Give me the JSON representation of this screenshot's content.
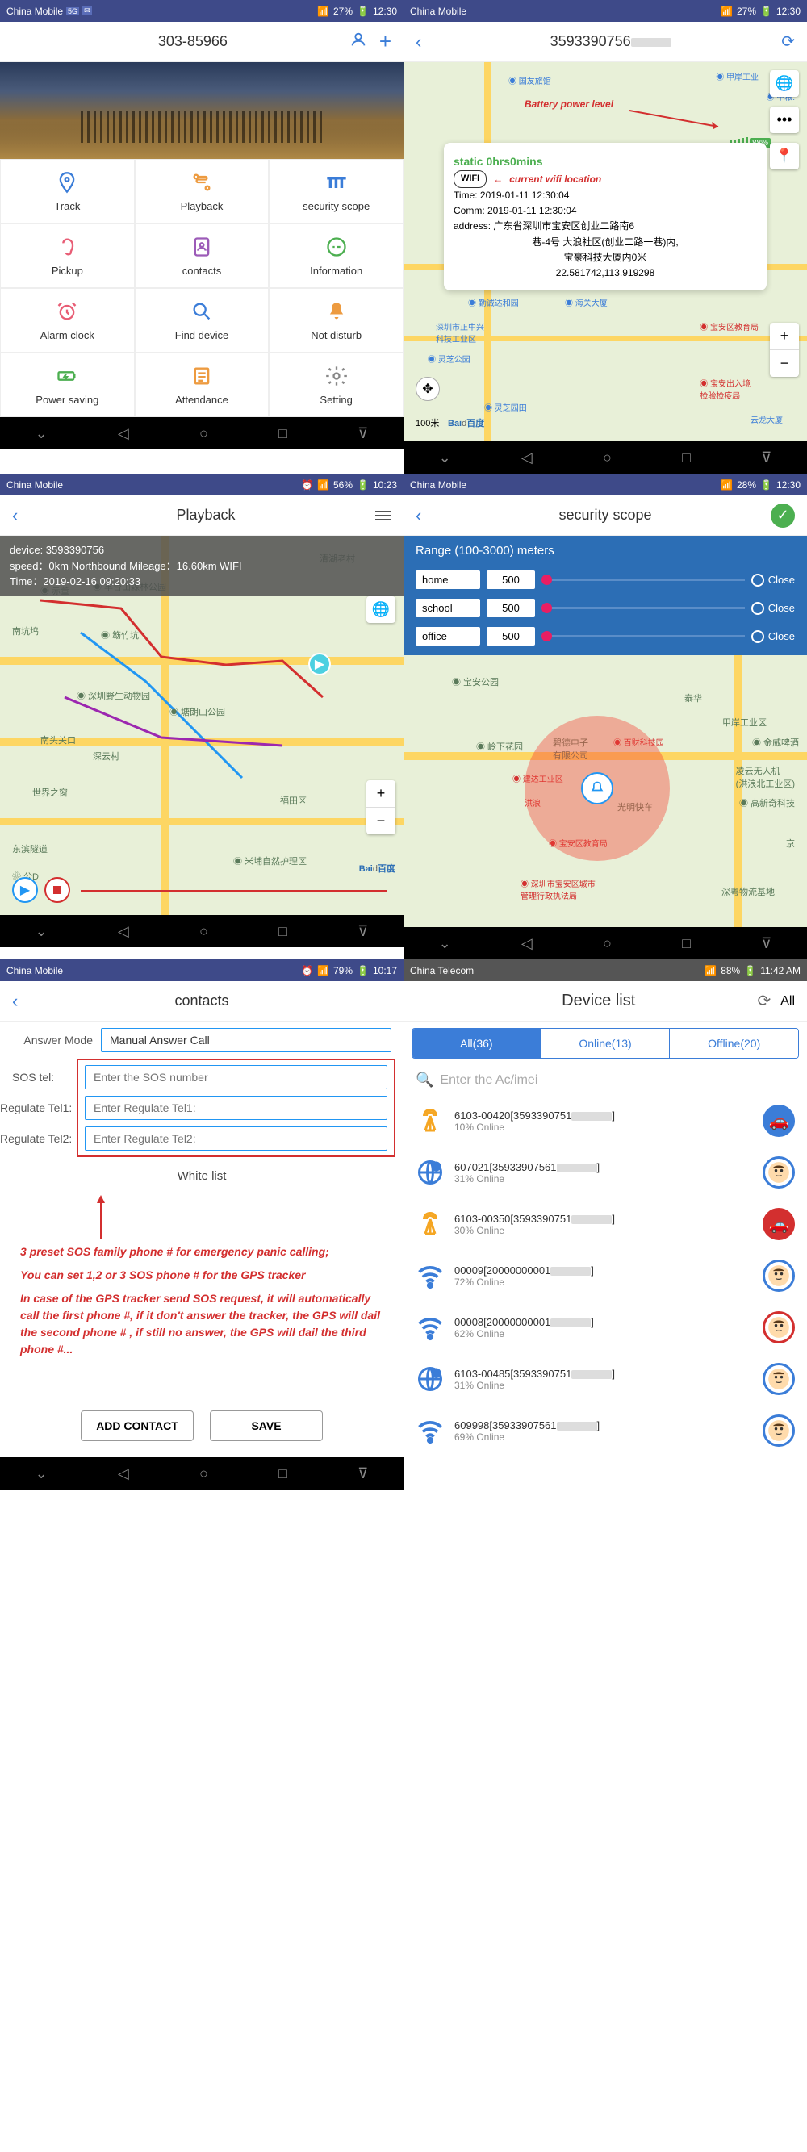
{
  "status": {
    "carrier_cm": "China Mobile",
    "carrier_ct": "China Telecom",
    "battery_27": "27%",
    "battery_28": "28%",
    "battery_56": "56%",
    "battery_79": "79%",
    "battery_88": "88%",
    "time_1230": "12:30",
    "time_1023": "10:23",
    "time_1017": "10:17",
    "time_1142": "11:42 AM"
  },
  "screen1": {
    "title": "303-85966",
    "menu": [
      {
        "label": "Track",
        "icon": "location"
      },
      {
        "label": "Playback",
        "icon": "route"
      },
      {
        "label": "security scope",
        "icon": "fence"
      },
      {
        "label": "Pickup",
        "icon": "ear"
      },
      {
        "label": "contacts",
        "icon": "contacts"
      },
      {
        "label": "Information",
        "icon": "info"
      },
      {
        "label": "Alarm clock",
        "icon": "clock"
      },
      {
        "label": "Find device",
        "icon": "search"
      },
      {
        "label": "Not disturb",
        "icon": "bell"
      },
      {
        "label": "Power saving",
        "icon": "power"
      },
      {
        "label": "Attendance",
        "icon": "attendance"
      },
      {
        "label": "Setting",
        "icon": "gear"
      }
    ]
  },
  "screen2": {
    "title": "3593390756",
    "ann_battery": "Battery power level",
    "ann_wifi": "current wifi location",
    "battery_pct": "88%",
    "card": {
      "status": "static 0hrs0mins",
      "wifi": "WIFI",
      "time": "Time: 2019-01-11 12:30:04",
      "comm": "Comm: 2019-01-11 12:30:04",
      "addr1": "address: 广东省深圳市宝安区创业二路南6",
      "addr2": "巷-4号 大浪社区(创业二路一巷)内,",
      "addr3": "宝豪科技大厦内0米",
      "coords": "22.581742,113.919298"
    },
    "scale": "100米"
  },
  "screen3": {
    "title": "Playback",
    "info_device": "device: 3593390756",
    "info_speed": "speed：0km Northbound Mileage：16.60km WIFI",
    "info_time": "Time：2019-02-16 09:20:33"
  },
  "screen4": {
    "title": "security scope",
    "range_label": "Range (100-3000) meters",
    "rows": [
      {
        "name": "home",
        "val": "500"
      },
      {
        "name": "school",
        "val": "500"
      },
      {
        "name": "office",
        "val": "500"
      }
    ],
    "close": "Close"
  },
  "screen5": {
    "title": "contacts",
    "answer_label": "Answer Mode",
    "answer_val": "Manual Answer Call",
    "sos_label": "SOS tel:",
    "sos_ph": "Enter the SOS number",
    "reg1_label": "Regulate Tel1:",
    "reg1_ph": "Enter Regulate Tel1:",
    "reg2_label": "Regulate Tel2:",
    "reg2_ph": "Enter Regulate Tel2:",
    "whitelist": "White list",
    "help1": "3 preset SOS family phone # for emergency panic calling;",
    "help2": "You can set 1,2 or 3 SOS phone # for the GPS tracker",
    "help3": "In case of the GPS tracker send SOS request, it will automatically call the first phone #, if it don't answer the tracker, the GPS will dail the second phone # , if still no answer, the GPS will dail the third phone #...",
    "btn_add": "ADD CONTACT",
    "btn_save": "SAVE"
  },
  "screen6": {
    "title": "Device list",
    "all": "All",
    "tabs": [
      {
        "label": "All(36)",
        "active": true
      },
      {
        "label": "Online(13)",
        "active": false
      },
      {
        "label": "Offline(20)",
        "active": false
      }
    ],
    "search_ph": "Enter the Ac/imei",
    "devices": [
      {
        "name": "6103-00420[3593390751",
        "status": "10%  Online",
        "icon": "tower",
        "avatar": "car",
        "color": "#3b7dd8"
      },
      {
        "name": "607021[35933907561",
        "status": "31%  Online",
        "icon": "gps",
        "avatar": "face",
        "color": "#3b7dd8"
      },
      {
        "name": "6103-00350[3593390751",
        "status": "30%  Online",
        "icon": "tower",
        "avatar": "car",
        "color": "#d32f2f"
      },
      {
        "name": "00009[20000000001",
        "status": "72%  Online",
        "icon": "wifi",
        "avatar": "face",
        "color": "#3b7dd8"
      },
      {
        "name": "00008[20000000001",
        "status": "62%  Online",
        "icon": "wifi",
        "avatar": "face",
        "color": "#d32f2f"
      },
      {
        "name": "6103-00485[3593390751",
        "status": "31%  Online",
        "icon": "gps",
        "avatar": "face",
        "color": "#3b7dd8"
      },
      {
        "name": "609998[35933907561",
        "status": "69%  Online",
        "icon": "wifi",
        "avatar": "face",
        "color": "#3b7dd8"
      }
    ]
  }
}
